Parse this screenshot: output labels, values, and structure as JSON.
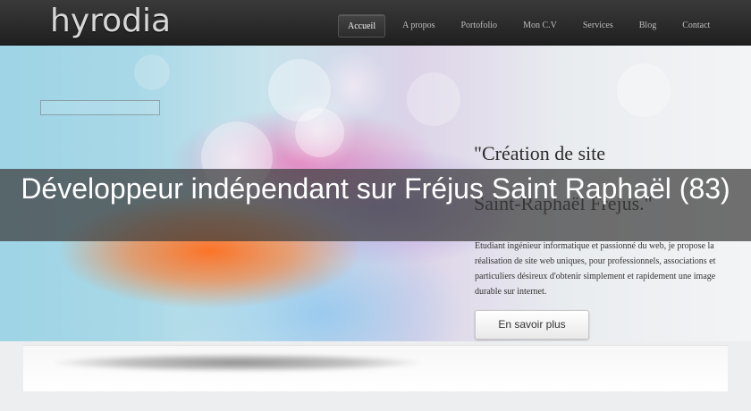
{
  "header": {
    "logo_text": "hyrodia",
    "nav": [
      "Accueil",
      "A propos",
      "Portofolio",
      "Mon C.V",
      "Services",
      "Blog",
      "Contact"
    ],
    "active_index": 0
  },
  "hero": {
    "quote": "\"Création de site\n\nSaint-Raphaël Fréjus.\"",
    "description": "Etudiant ingénieur informatique et passionné du web, je propose la réalisation de site web uniques, pour professionnels, associations et particuliers désireux d'obtenir simplement et rapidement une image durable sur internet.",
    "button_label": "En savoir plus"
  },
  "banner": {
    "title": "Développeur indépendant sur Fréjus Saint Raphaël (83)"
  },
  "colors": {
    "header_bg": "#2a2a2a",
    "banner_bg": "rgba(60,60,60,0.72)",
    "page_bg": "#eceeef"
  }
}
